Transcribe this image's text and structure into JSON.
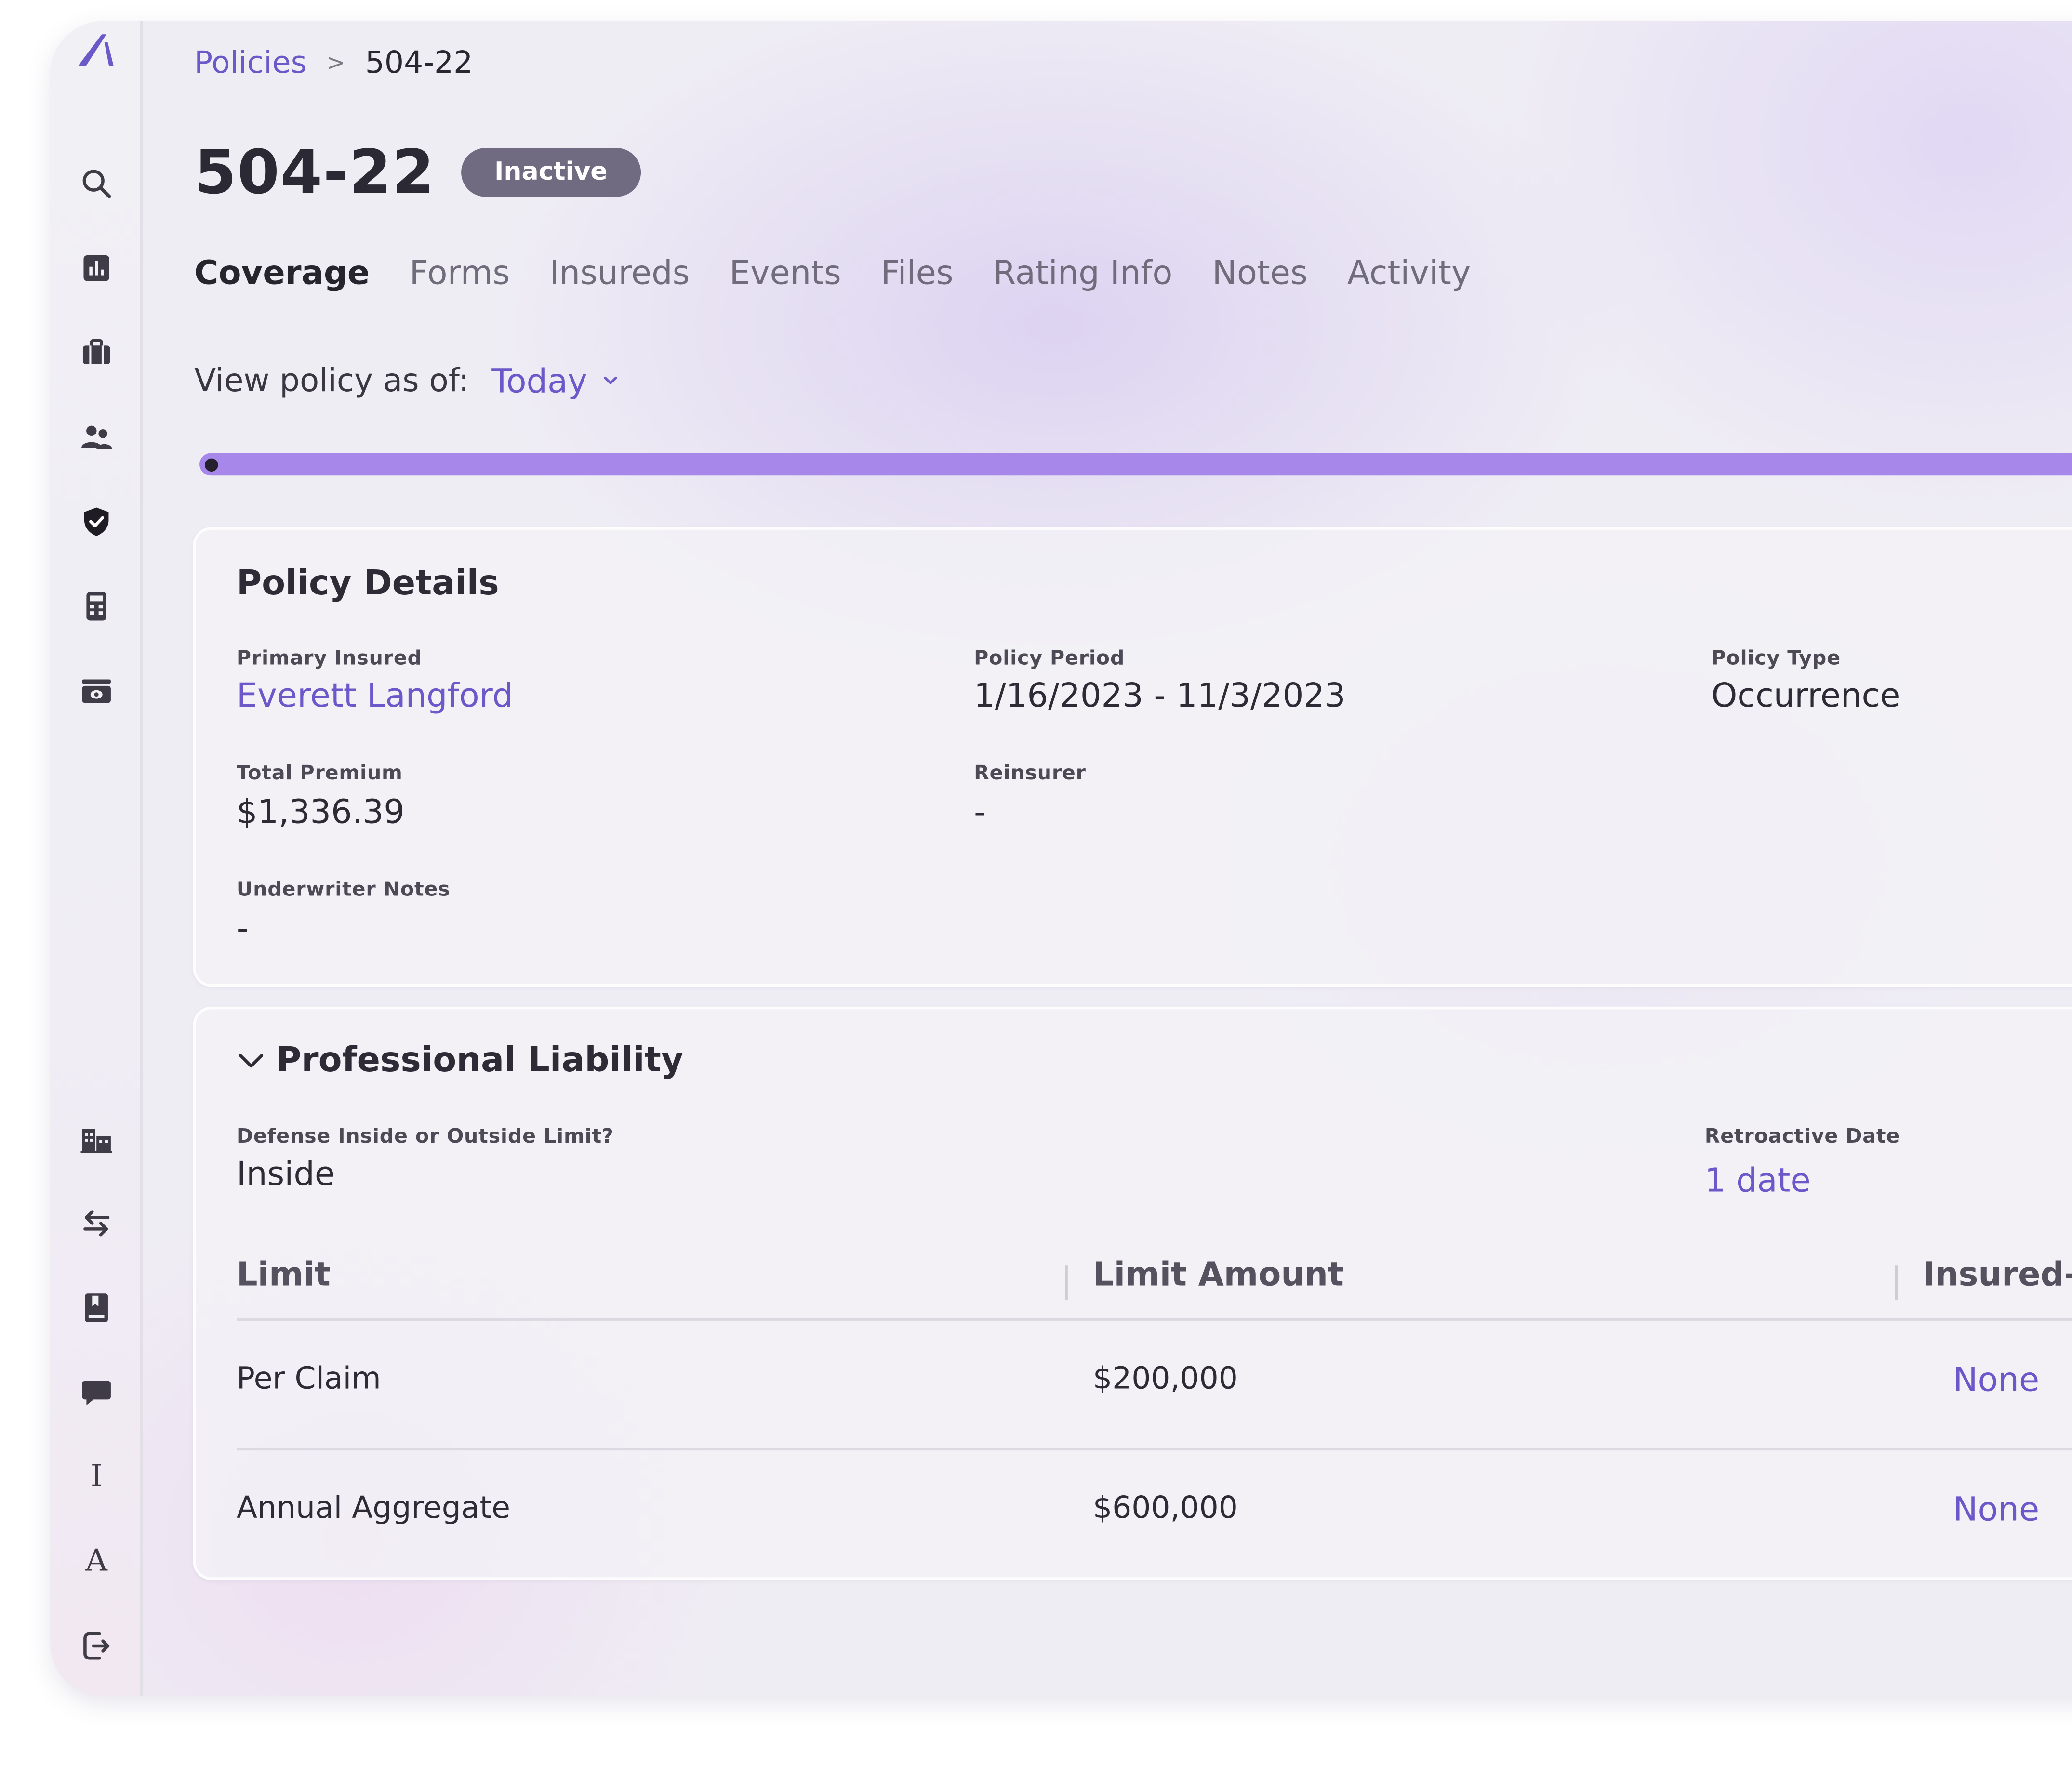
{
  "breadcrumb": {
    "parent": "Policies",
    "separator": ">",
    "current": "504-22"
  },
  "header": {
    "title": "504-22",
    "status": "Inactive"
  },
  "tabs": [
    {
      "label": "Coverage",
      "active": true
    },
    {
      "label": "Forms",
      "active": false
    },
    {
      "label": "Insureds",
      "active": false
    },
    {
      "label": "Events",
      "active": false
    },
    {
      "label": "Files",
      "active": false
    },
    {
      "label": "Rating Info",
      "active": false
    },
    {
      "label": "Notes",
      "active": false
    },
    {
      "label": "Activity",
      "active": false
    }
  ],
  "view_as": {
    "label": "View policy as of:",
    "value": "Today"
  },
  "sidebar": {
    "logo": "app-logo",
    "top_icons": [
      "search-icon",
      "chart-icon",
      "briefcase-icon",
      "users-icon",
      "shield-icon",
      "calculator-icon",
      "ticket-icon"
    ],
    "bottom_icons": [
      "building-icon",
      "transfer-icon",
      "book-icon",
      "chat-icon",
      "text-cursor-icon",
      "font-icon",
      "logout-icon"
    ],
    "letters": {
      "text_cursor": "I",
      "font": "A"
    },
    "active": "shield-icon"
  },
  "policy_details": {
    "title": "Policy Details",
    "primary_insured": {
      "label": "Primary Insured",
      "value": "Everett Langford"
    },
    "policy_period": {
      "label": "Policy Period",
      "value": "1/16/2023 - 11/3/2023"
    },
    "policy_type": {
      "label": "Policy Type",
      "value": "Occurrence"
    },
    "total_premium": {
      "label": "Total Premium",
      "value": "$1,336.39"
    },
    "reinsurer": {
      "label": "Reinsurer",
      "value": "-"
    },
    "underwriter_notes": {
      "label": "Underwriter Notes",
      "value": "-"
    }
  },
  "professional_liability": {
    "title": "Professional Liability",
    "defense": {
      "label": "Defense Inside or Outside Limit?",
      "value": "Inside"
    },
    "retroactive_date": {
      "label": "Retroactive Date",
      "value": "1 date"
    },
    "table": {
      "columns": [
        "Limit",
        "Limit Amount",
        "Insured-S"
      ],
      "rows": [
        {
          "limit": "Per Claim",
          "amount": "$200,000",
          "insured": "None"
        },
        {
          "limit": "Annual Aggregate",
          "amount": "$600,000",
          "insured": "None"
        }
      ]
    }
  },
  "colors": {
    "accent": "#6b58c9",
    "timeline": "#a887ea",
    "badge": "#716b82",
    "text": "#2e2b36"
  }
}
